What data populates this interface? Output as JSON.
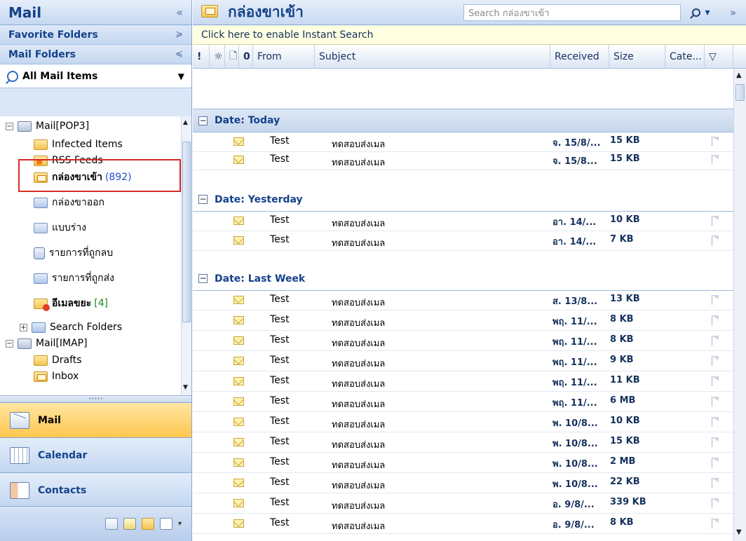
{
  "nav": {
    "title": "Mail",
    "collapse_glyph": "«",
    "favorite_folders": "Favorite Folders",
    "favorite_chevron": "≽",
    "mail_folders": "Mail Folders",
    "mail_folders_chevron": "≼",
    "all_mail_items": "All Mail Items",
    "tree": [
      {
        "label": "Mail[POP3]",
        "icon": "mailbox-icon"
      },
      {
        "label": "Infected Items",
        "icon": "folder-icon"
      },
      {
        "label": "RSS Feeds",
        "icon": "rss-folder-icon"
      },
      {
        "label": "กล่องขาเข้า",
        "count": "(892)",
        "icon": "inbox-folder-icon"
      },
      {
        "label": "กล่องขาออก",
        "icon": "outbox-folder-icon"
      },
      {
        "label": "แบบร่าง",
        "icon": "drafts-folder-icon"
      },
      {
        "label": "รายการที่ถูกลบ",
        "icon": "deleted-items-icon"
      },
      {
        "label": "รายการที่ถูกส่ง",
        "icon": "sent-items-icon"
      },
      {
        "label": "อีเมลขยะ",
        "count": "[4]",
        "icon": "junk-folder-icon"
      },
      {
        "label": "Search Folders",
        "icon": "search-folder-icon"
      },
      {
        "label": "Mail[IMAP]",
        "icon": "mailbox-icon"
      },
      {
        "label": "Drafts",
        "icon": "folder-icon"
      },
      {
        "label": "Inbox",
        "icon": "inbox-folder-icon"
      }
    ],
    "buttons": {
      "mail": "Mail",
      "calendar": "Calendar",
      "contacts": "Contacts"
    }
  },
  "main": {
    "folder_title": "กล่องขาเข้า",
    "search_placeholder": "Search กล่องขาเข้า",
    "collapse_glyph": "»",
    "instant_search": "Click here to enable Instant Search",
    "columns": {
      "importance": "!",
      "reminder": "☼",
      "icon": "🗋",
      "attachment": "0",
      "from": "From",
      "subject": "Subject",
      "received": "Received",
      "size": "Size",
      "categories": "Cate...",
      "flag": "▽"
    },
    "groups": [
      {
        "label": "Date: Today",
        "messages": [
          {
            "from": "Test",
            "subject": "ทดสอบส่งเมล",
            "received": "จ. 15/8/...",
            "size": "15 KB"
          },
          {
            "from": "Test",
            "subject": "ทดสอบส่งเมล",
            "received": "จ. 15/8...",
            "size": "15 KB"
          }
        ]
      },
      {
        "label": "Date: Yesterday",
        "messages": [
          {
            "from": "Test",
            "subject": "ทดสอบส่งเมล",
            "received": "อา. 14/...",
            "size": "10 KB"
          },
          {
            "from": "Test",
            "subject": "ทดสอบส่งเมล",
            "received": "อา. 14/...",
            "size": "7 KB"
          }
        ]
      },
      {
        "label": "Date: Last Week",
        "messages": [
          {
            "from": "Test",
            "subject": "ทดสอบส่งเมล",
            "received": "ส. 13/8...",
            "size": "13 KB"
          },
          {
            "from": "Test",
            "subject": "ทดสอบส่งเมล",
            "received": "พฤ. 11/...",
            "size": "8 KB"
          },
          {
            "from": "Test",
            "subject": "ทดสอบส่งเมล",
            "received": "พฤ. 11/...",
            "size": "8 KB"
          },
          {
            "from": "Test",
            "subject": "ทดสอบส่งเมล",
            "received": "พฤ. 11/...",
            "size": "9 KB"
          },
          {
            "from": "Test",
            "subject": "ทดสอบส่งเมล",
            "received": "พฤ. 11/...",
            "size": "11 KB"
          },
          {
            "from": "Test",
            "subject": "ทดสอบส่งเมล",
            "received": "พฤ. 11/...",
            "size": "6 MB"
          },
          {
            "from": "Test",
            "subject": "ทดสอบส่งเมล",
            "received": "พ. 10/8...",
            "size": "10 KB"
          },
          {
            "from": "Test",
            "subject": "ทดสอบส่งเมล",
            "received": "พ. 10/8...",
            "size": "15 KB"
          },
          {
            "from": "Test",
            "subject": "ทดสอบส่งเมล",
            "received": "พ. 10/8...",
            "size": "2 MB"
          },
          {
            "from": "Test",
            "subject": "ทดสอบส่งเมล",
            "received": "พ. 10/8...",
            "size": "22 KB"
          },
          {
            "from": "Test",
            "subject": "ทดสอบส่งเมล",
            "received": "อ. 9/8/...",
            "size": "339 KB"
          },
          {
            "from": "Test",
            "subject": "ทดสอบส่งเมล",
            "received": "อ. 9/8/...",
            "size": "8 KB"
          }
        ]
      }
    ]
  },
  "colors": {
    "accent": "#15428b",
    "active_nav": "#ffc64f",
    "highlight_box": "#d52a26",
    "instant_bar": "#ffffe1"
  }
}
